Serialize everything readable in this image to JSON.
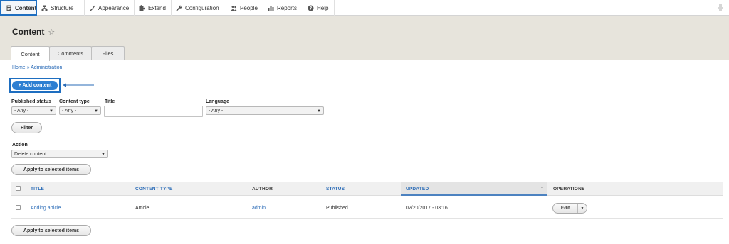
{
  "toolbar": {
    "items": [
      {
        "label": "Content",
        "icon": "content-icon"
      },
      {
        "label": "Structure",
        "icon": "structure-icon"
      },
      {
        "label": "Appearance",
        "icon": "appearance-icon"
      },
      {
        "label": "Extend",
        "icon": "extend-icon"
      },
      {
        "label": "Configuration",
        "icon": "configuration-icon"
      },
      {
        "label": "People",
        "icon": "people-icon"
      },
      {
        "label": "Reports",
        "icon": "reports-icon"
      },
      {
        "label": "Help",
        "icon": "help-icon"
      }
    ],
    "right_icon": "toggle-orientation-icon"
  },
  "page": {
    "title": "Content",
    "star": "☆"
  },
  "tabs": [
    "Content",
    "Comments",
    "Files"
  ],
  "breadcrumb": "Home » Administration",
  "add_content_label": "+ Add content",
  "filters": {
    "published_status": {
      "label": "Published status",
      "value": "- Any -"
    },
    "content_type": {
      "label": "Content type",
      "value": "- Any -"
    },
    "title": {
      "label": "Title",
      "value": ""
    },
    "language": {
      "label": "Language",
      "value": "- Any -"
    },
    "filter_button": "Filter"
  },
  "action": {
    "label": "Action",
    "value": "Delete content",
    "apply_button": "Apply to selected items"
  },
  "table": {
    "headers": [
      "TITLE",
      "CONTENT TYPE",
      "AUTHOR",
      "STATUS",
      "UPDATED",
      "OPERATIONS"
    ],
    "rows": [
      {
        "title": "Adding article",
        "content_type": "Article",
        "author": "admin",
        "status": "Published",
        "updated": "02/20/2017 - 03:16",
        "operation": "Edit"
      }
    ]
  },
  "bottom_apply_button": "Apply to selected items",
  "colors": {
    "accent": "#2d7fd2",
    "highlight_border": "#1e6ec0",
    "link": "#2a6bb7",
    "header_bg": "#e7e4dc"
  }
}
